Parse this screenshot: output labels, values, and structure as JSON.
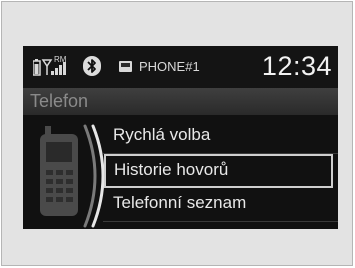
{
  "status": {
    "bluetooth_symbol": "ʙ",
    "signal_text": "RM",
    "phone_name": "PHONE#1",
    "clock": "12:34"
  },
  "screen": {
    "title": "Telefon"
  },
  "menu": {
    "items": [
      {
        "label": "Rychlá volba"
      },
      {
        "label": "Historie hovorů"
      },
      {
        "label": "Telefonní seznam"
      }
    ],
    "selected_index": 1
  },
  "colors": {
    "screen_background": "#111111",
    "text": "#e8e8e8",
    "title_text": "#8a8a8a",
    "selection_border": "#cfcfcf"
  },
  "icons": {
    "battery": "battery-icon",
    "signal": "signal-strength-icon",
    "bluetooth": "bluetooth-icon",
    "phone": "phone-icon",
    "handset": "mobile-phone-icon"
  }
}
